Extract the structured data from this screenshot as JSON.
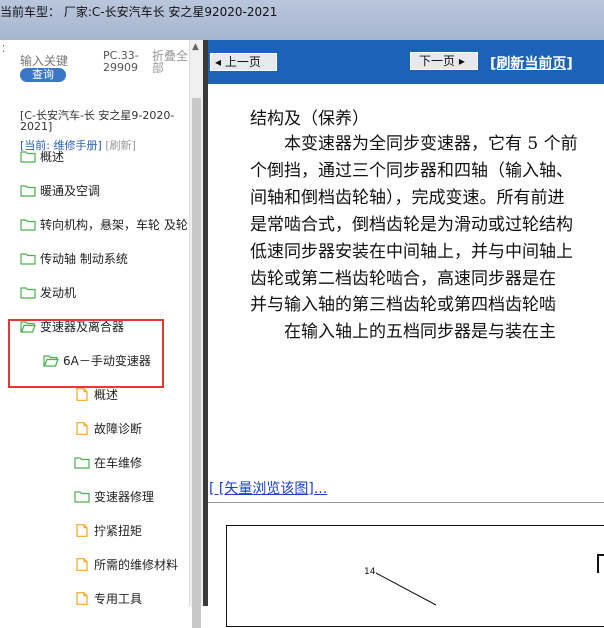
{
  "titlebar": {
    "text": "当前车型：  厂家:C-长安汽车长 安之星92020-2021"
  },
  "search": {
    "keyword_label": "输入关键",
    "search_button": "查询",
    "pc_code": "PC.33-29909",
    "fold_all": "折叠全部"
  },
  "vehicle": {
    "name": "[C-长安汽车-长 安之星9-2020-2021]",
    "current_label": "[当前: 维修手册]",
    "refresh_label": "[刷新]"
  },
  "tree": [
    {
      "label": "概述",
      "type": "folder"
    },
    {
      "label": "暖通及空调",
      "type": "folder"
    },
    {
      "label": "转向机构，悬架，车轮 及轮",
      "type": "folder"
    },
    {
      "label": "传动轴 制动系统",
      "type": "folder"
    },
    {
      "label": "发动机",
      "type": "folder"
    },
    {
      "label": "变速器及离合器",
      "type": "folder-open"
    },
    {
      "label": "6A－手动变速器",
      "type": "folder-open"
    },
    {
      "label": "概述",
      "type": "doc"
    },
    {
      "label": "故障诊断",
      "type": "doc"
    },
    {
      "label": "在车维修",
      "type": "folder"
    },
    {
      "label": "变速器修理",
      "type": "folder"
    },
    {
      "label": "拧紧扭矩",
      "type": "doc"
    },
    {
      "label": "所需的维修材料",
      "type": "doc"
    },
    {
      "label": "专用工具",
      "type": "doc"
    }
  ],
  "nav": {
    "prev": "上一页",
    "next": "下一页",
    "refresh": "[刷新当前页]"
  },
  "document": {
    "title": "结构及（保养）",
    "lines": [
      "　　本变速器为全同步变速器，它有 5 个前",
      "个倒挡，通过三个同步器和四轴（输入轴、",
      "间轴和倒档齿轮轴），完成变速。所有前进",
      "是常啮合式，倒档齿轮是为滑动或过轮结构",
      "低速同步器安装在中间轴上，并与中间轴上",
      "齿轮或第二档齿轮啮合，高速同步器是在",
      "并与输入轴的第三档齿轮或第四档齿轮啮",
      "　　在输入轴上的五档同步器是与装在主"
    ],
    "vector_link": "[ [矢量浏览该图]..."
  },
  "figure": {
    "callout": "14"
  },
  "colors": {
    "nav_blue": "#1a63b8",
    "highlight_red": "#e53935",
    "folder_green": "#4caf50",
    "doc_orange": "#f5a623"
  }
}
